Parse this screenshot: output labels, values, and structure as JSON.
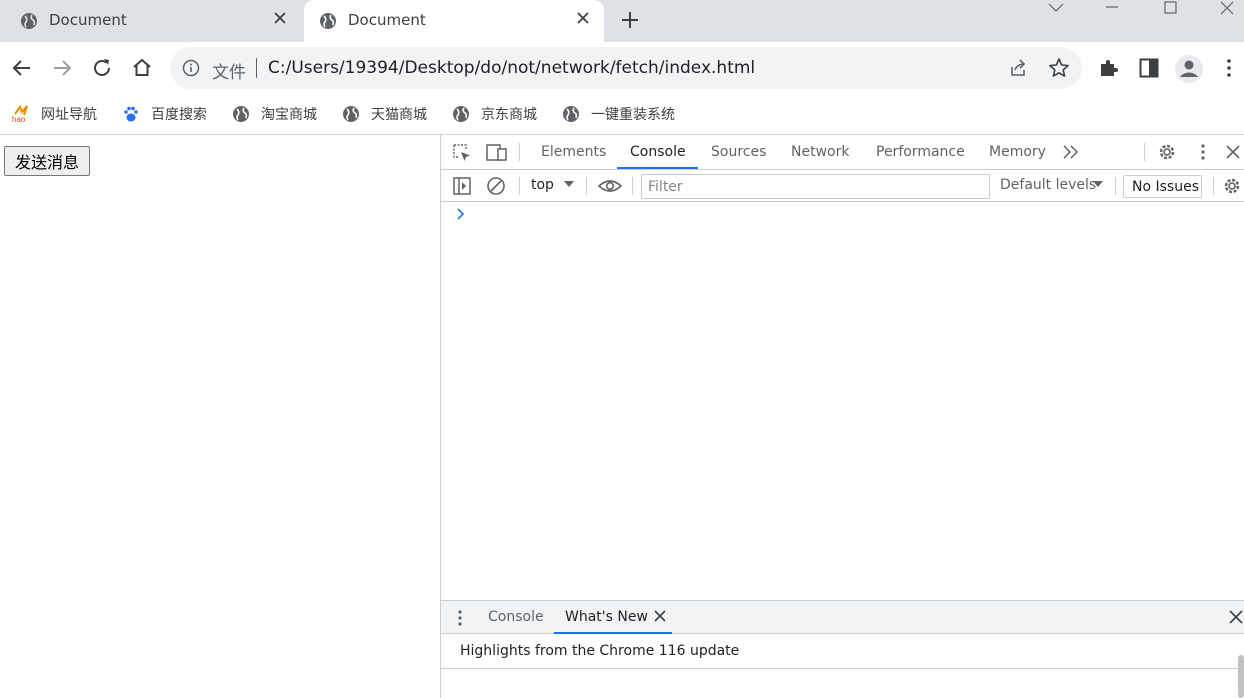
{
  "tabs": [
    {
      "title": "Document",
      "active": false
    },
    {
      "title": "Document",
      "active": true
    }
  ],
  "omnibox": {
    "scheme_label": "文件",
    "url": "C:/Users/19394/Desktop/do/not/network/fetch/index.html"
  },
  "bookmarks": [
    {
      "label": "网址导航",
      "icon": "hao-icon"
    },
    {
      "label": "百度搜索",
      "icon": "baidu-paw-icon"
    },
    {
      "label": "淘宝商城",
      "icon": "globe-icon"
    },
    {
      "label": "天猫商城",
      "icon": "globe-icon"
    },
    {
      "label": "京东商城",
      "icon": "globe-icon"
    },
    {
      "label": "一键重装系统",
      "icon": "globe-icon"
    }
  ],
  "page": {
    "send_button": "发送消息"
  },
  "devtools": {
    "tabs": [
      "Elements",
      "Console",
      "Sources",
      "Network",
      "Performance",
      "Memory"
    ],
    "active_tab": "Console",
    "context": "top",
    "filter_placeholder": "Filter",
    "levels": "Default levels",
    "issues": "No Issues",
    "prompt": ">",
    "drawer": {
      "tabs": [
        "Console",
        "What's New"
      ],
      "active_tab": "What's New",
      "highlights": "Highlights from the Chrome 116 update"
    }
  },
  "colors": {
    "accent": "#1a73e8",
    "tabstrip": "#dee1e6",
    "omnibox": "#f1f3f4"
  }
}
